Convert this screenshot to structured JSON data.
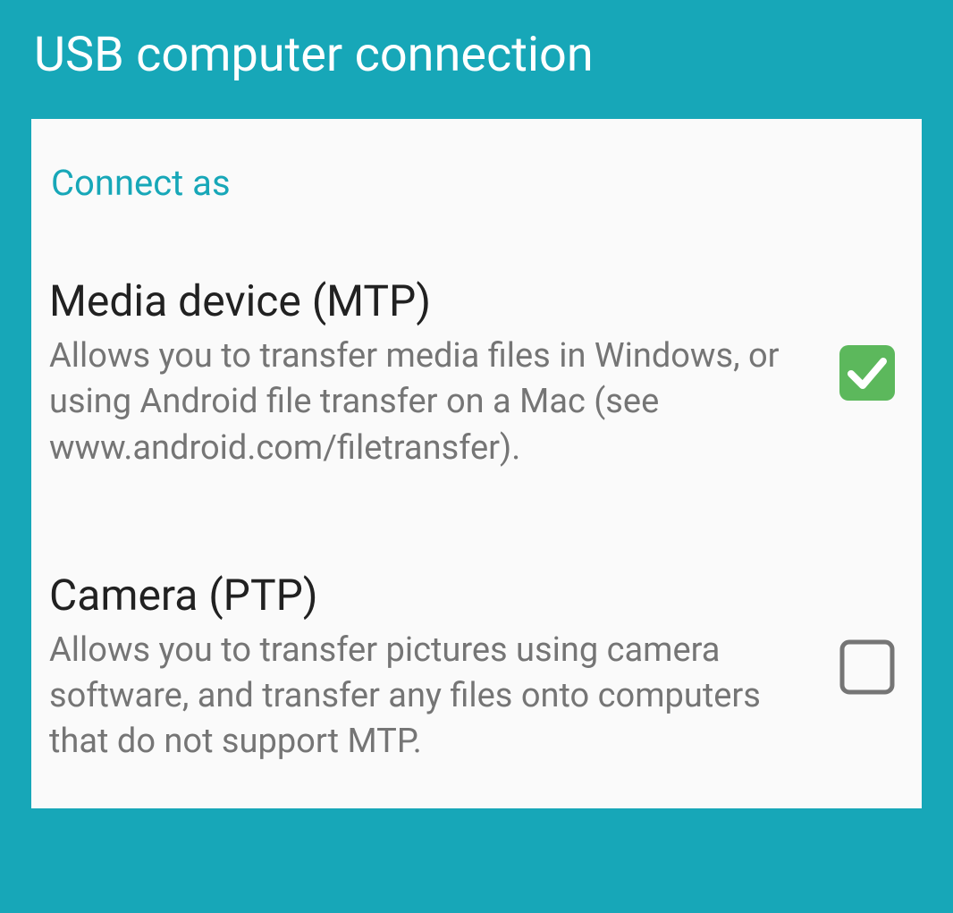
{
  "header": {
    "title": "USB computer connection"
  },
  "section": {
    "label": "Connect as"
  },
  "options": [
    {
      "title": "Media device (MTP)",
      "description": "Allows you to transfer media files in Windows, or using Android file transfer on a Mac (see www.android.com/filetransfer).",
      "checked": true
    },
    {
      "title": "Camera (PTP)",
      "description": "Allows you to transfer pictures using camera software, and transfer any files onto computers that do not support MTP.",
      "checked": false
    }
  ],
  "colors": {
    "brand": "#17a7b8",
    "checkboxChecked": "#5cb85c",
    "checkboxUnchecked": "#757575"
  }
}
